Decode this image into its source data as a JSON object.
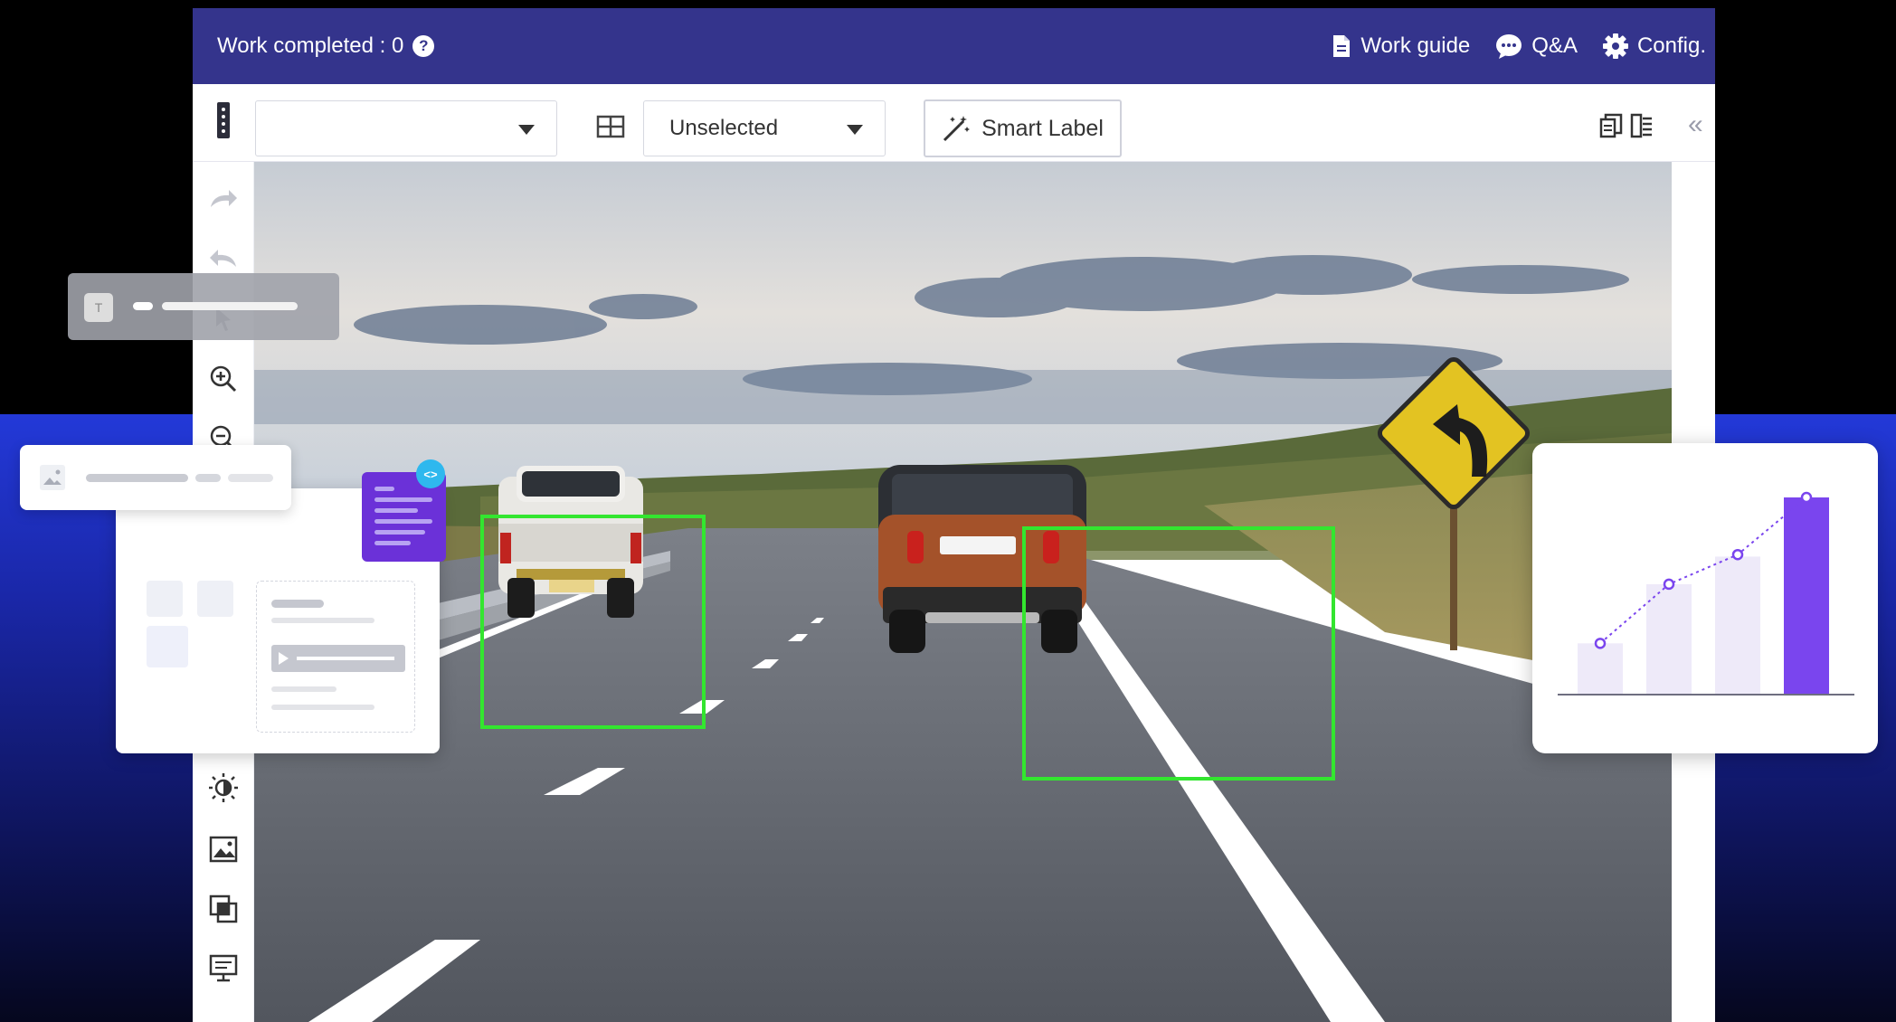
{
  "header": {
    "work_completed": "Work completed : 0",
    "help_icon": "question-circle-icon",
    "links": [
      {
        "label": "Work guide",
        "icon": "document-icon"
      },
      {
        "label": "Q&A",
        "icon": "chat-bubble-icon"
      },
      {
        "label": "Config.",
        "icon": "gear-icon"
      }
    ]
  },
  "toolbar": {
    "class_select_value": "",
    "status_select_value": "Unselected",
    "smart_label": "Smart Label"
  },
  "left_rail": {
    "icons": [
      "redo-icon",
      "undo-icon",
      "pointer-icon",
      "zoom-in-icon",
      "zoom-out-icon",
      "brightness-icon",
      "image-icon",
      "copy-icon",
      "presentation-icon"
    ]
  },
  "annotations": [
    {
      "object": "pickup-truck"
    },
    {
      "object": "suv-car"
    }
  ],
  "colors": {
    "header_bg": "#34348c",
    "bbox": "#33e62f",
    "accent_purple": "#6b31d8",
    "chart_bar_light": "#eeeaf9",
    "chart_bar_strong": "#7a45ee"
  },
  "chart_data": {
    "type": "bar",
    "title": "",
    "xlabel": "",
    "ylabel": "",
    "categories": [
      "",
      "",
      "",
      ""
    ],
    "series": [
      {
        "values": [
          0.26,
          0.56,
          0.7,
          1.0
        ]
      }
    ],
    "overlay_line_values": [
      0.26,
      0.56,
      0.71,
      1.0
    ],
    "ylim": [
      0,
      1
    ],
    "grid": false
  }
}
